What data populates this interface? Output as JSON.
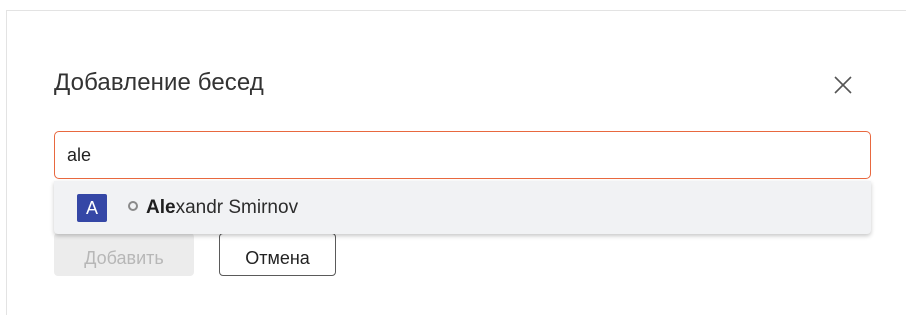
{
  "dialog": {
    "title": "Добавление бесед",
    "close_icon": "close-icon"
  },
  "search": {
    "value": "ale",
    "border_color": "#e8683f"
  },
  "suggestions": [
    {
      "avatar_letter": "A",
      "avatar_color": "#3547a6",
      "status_icon": "presence-offline-icon",
      "name_match": "Ale",
      "name_rest": "xandr Smirnov"
    }
  ],
  "buttons": {
    "add_label": "Добавить",
    "cancel_label": "Отмена"
  }
}
